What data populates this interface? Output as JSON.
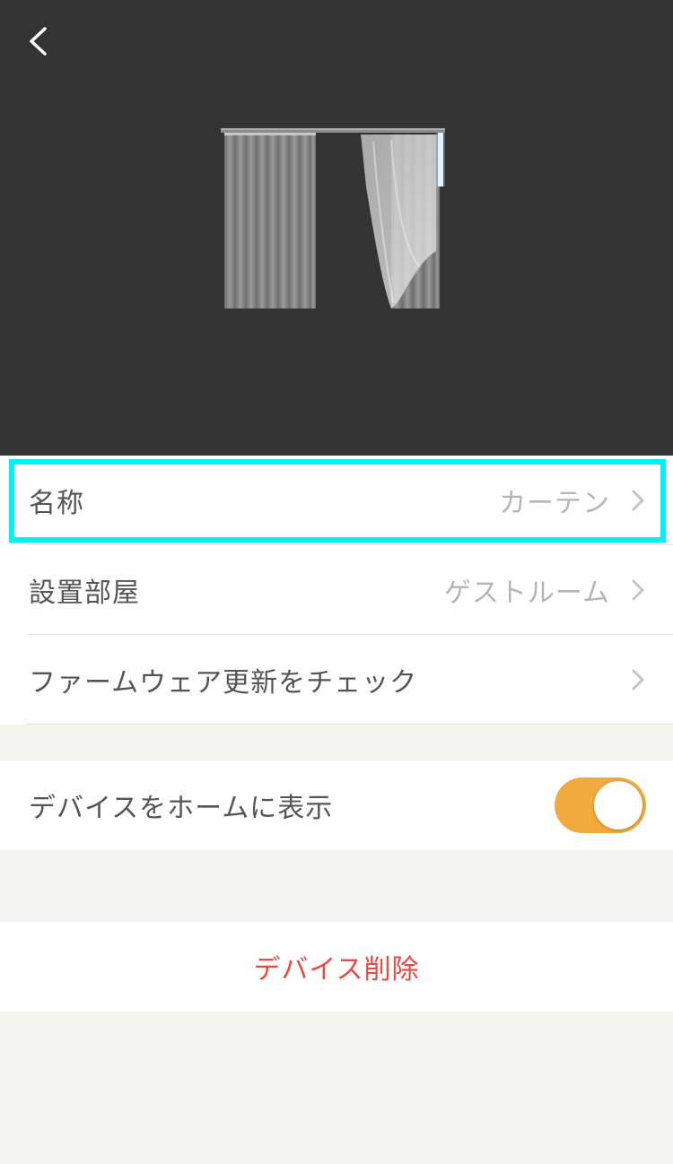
{
  "header": {
    "back_icon": "chevron-left-icon"
  },
  "device": {
    "image_icon": "curtain-illustration"
  },
  "settings": {
    "name_label": "名称",
    "name_value": "カーテン",
    "room_label": "設置部屋",
    "room_value": "ゲストルーム",
    "firmware_label": "ファームウェア更新をチェック"
  },
  "home_display": {
    "label": "デバイスをホームに表示",
    "enabled": true
  },
  "actions": {
    "delete_label": "デバイス削除"
  },
  "colors": {
    "hero_bg": "#333333",
    "accent": "#f0aa3e",
    "danger": "#e84a44",
    "highlight": "#00f0f8"
  }
}
